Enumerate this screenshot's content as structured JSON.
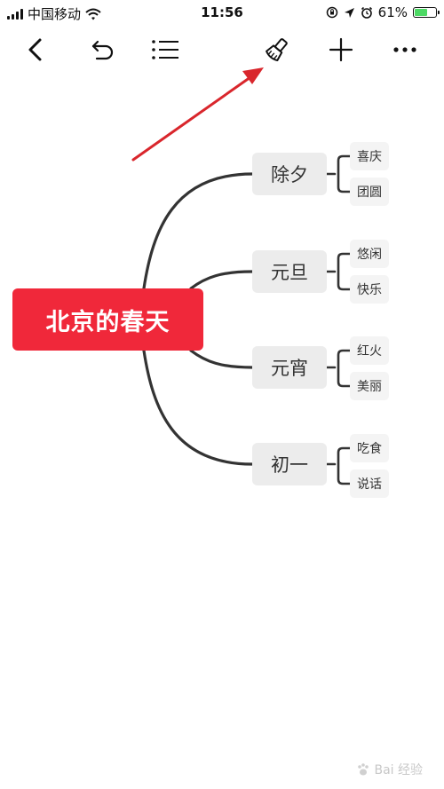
{
  "status_bar": {
    "carrier": "中国移动",
    "time": "11:56",
    "battery_percent": "61%",
    "battery_level": 0.61,
    "battery_color": "#4cd964"
  },
  "toolbar": {
    "icons": [
      "back-icon",
      "undo-icon",
      "outline-list-icon",
      "format-brush-icon",
      "add-icon",
      "more-icon"
    ]
  },
  "mindmap": {
    "root": {
      "label": "北京的春天",
      "color": "#f0283a"
    },
    "branches": [
      {
        "label": "除夕",
        "children": [
          "喜庆",
          "团圆"
        ]
      },
      {
        "label": "元旦",
        "children": [
          "悠闲",
          "快乐"
        ]
      },
      {
        "label": "元宵",
        "children": [
          "红火",
          "美丽"
        ]
      },
      {
        "label": "初一",
        "children": [
          "吃食",
          "说话"
        ]
      }
    ]
  },
  "annotation": {
    "arrow_color": "#d9262c"
  },
  "watermark": {
    "text": "Bai 经验"
  }
}
